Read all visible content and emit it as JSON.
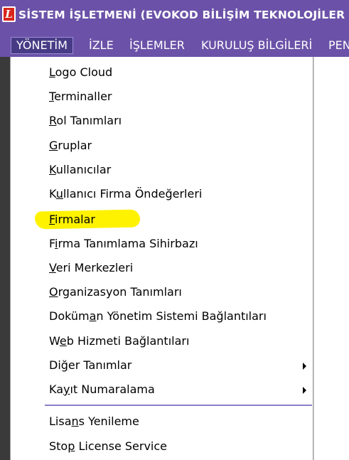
{
  "window": {
    "icon_letter": "L",
    "title": "SİSTEM İŞLETMENİ (EVOKOD BİLİŞİM TEKNOLOJİLER"
  },
  "menubar": {
    "items": [
      {
        "label": "YÖNETİM"
      },
      {
        "label": "İZLE"
      },
      {
        "label": "İŞLEMLER"
      },
      {
        "label": "KURULUŞ BİLGİLERİ"
      },
      {
        "label": "PEN"
      }
    ]
  },
  "dropdown": {
    "items": [
      {
        "mnemonic": "L",
        "rest": "ogo Cloud"
      },
      {
        "mnemonic": "T",
        "rest": "erminaller"
      },
      {
        "pre": "",
        "mnemonic": "R",
        "rest": "ol Tanımları"
      },
      {
        "mnemonic": "G",
        "rest": "ruplar"
      },
      {
        "mnemonic": "K",
        "rest": "ullanıcılar"
      },
      {
        "pre": "K",
        "mnemonic": "u",
        "rest": "llanıcı Firma Öndeğerleri"
      },
      {
        "mnemonic": "F",
        "rest": "irmalar"
      },
      {
        "pre": "F",
        "mnemonic": "i",
        "rest": "rma Tanımlama Sihirbazı"
      },
      {
        "mnemonic": "V",
        "rest": "eri Merkezleri"
      },
      {
        "mnemonic": "O",
        "rest": "rganizasyon Tanımları"
      },
      {
        "pre": "Doküm",
        "mnemonic": "a",
        "rest": "n Yönetim Sistemi Bağlantıları"
      },
      {
        "pre": "W",
        "mnemonic": "e",
        "rest": "b Hizmeti Bağlantıları"
      },
      {
        "pre": "Di",
        "mnemonic": "ğ",
        "rest": "er Tanımlar"
      },
      {
        "pre": "Ka",
        "mnemonic": "y",
        "rest": "ıt Numaralama"
      },
      {
        "pre": "Lisa",
        "mnemonic": "n",
        "rest": "s Yenileme"
      },
      {
        "pre": "Sto",
        "mnemonic": "p",
        "rest": " License Service"
      }
    ]
  },
  "colors": {
    "titlebar": "#6b52a8",
    "menubar_active": "#473b86",
    "highlight": "#fff200",
    "separator": "#8a7fc7"
  }
}
